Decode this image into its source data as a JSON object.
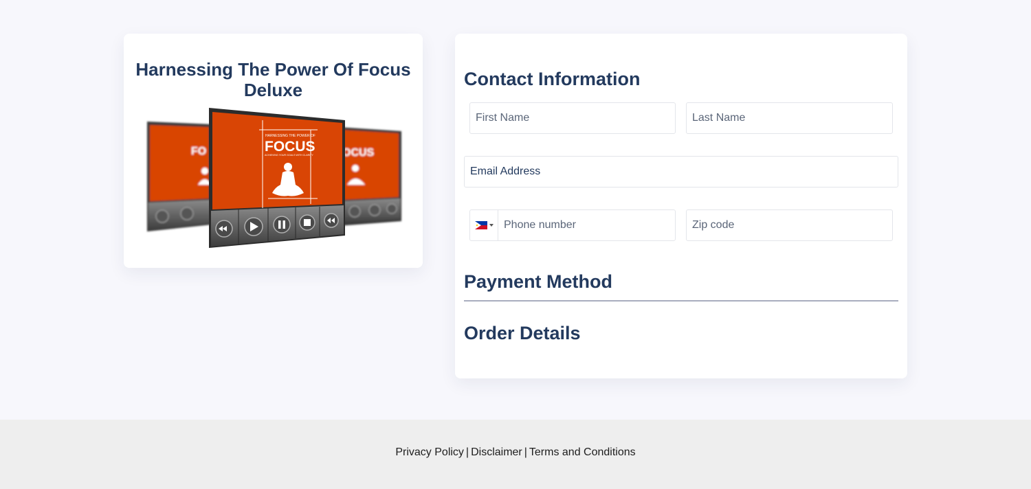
{
  "product": {
    "title": "Harnessing The Power Of Focus Deluxe",
    "image_text": {
      "top_line": "HARNESSING THE POWER OF",
      "main": "FOCUS",
      "sub_line": "ACHIEVING YOUR GOALS WITH CLARITY"
    }
  },
  "form": {
    "contact_title": "Contact Information",
    "first_name_placeholder": "First Name",
    "last_name_placeholder": "Last Name",
    "email_placeholder": "Email Address",
    "phone_country": "PH",
    "phone_placeholder": "Phone number",
    "zip_placeholder": "Zip code",
    "payment_title": "Payment Method",
    "order_title": "Order Details"
  },
  "footer": {
    "privacy": "Privacy Policy",
    "disclaimer": "Disclaimer",
    "terms": "Terms and Conditions",
    "separator": "|"
  },
  "colors": {
    "heading": "#233a5e",
    "product_orange": "#d94505",
    "page_bg": "#f7f7fc",
    "footer_bg": "#eeeeee"
  }
}
